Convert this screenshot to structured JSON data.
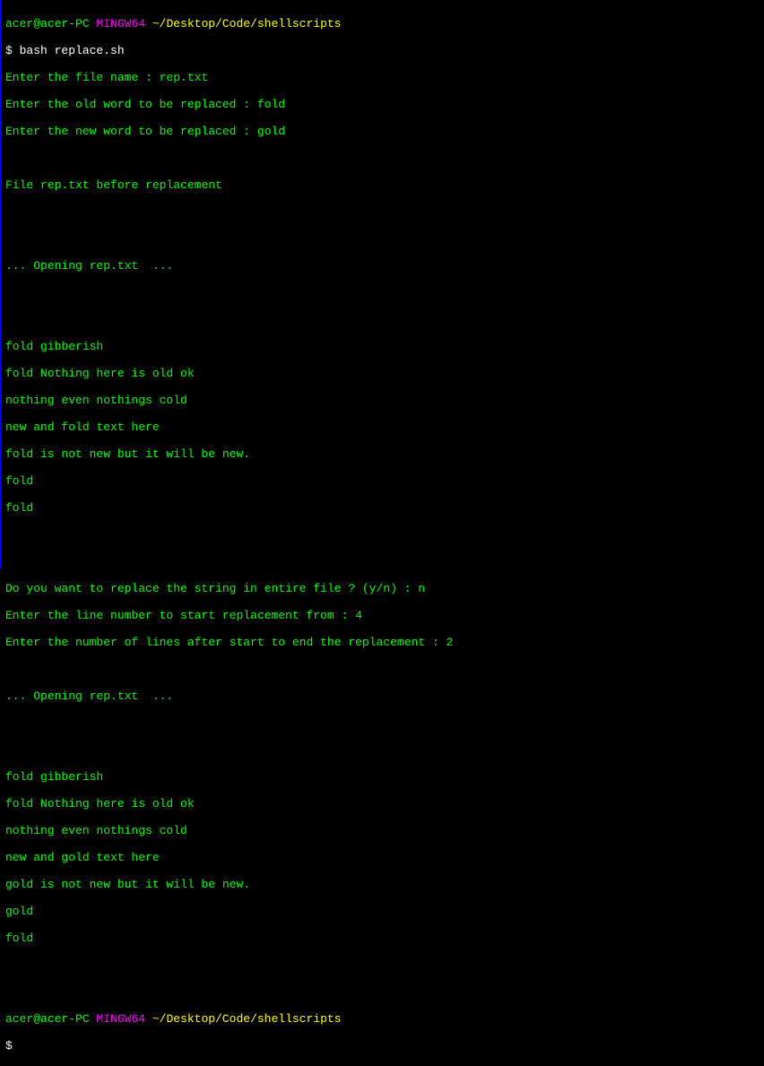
{
  "prompt1": {
    "user": "acer@acer-PC",
    "mingw": " MINGW64",
    "path": " ~/Desktop/Code/shellscripts"
  },
  "command1": {
    "dollar": "$ ",
    "cmd": "bash replace.sh"
  },
  "output": {
    "line1": "Enter the file name : rep.txt",
    "line2": "Enter the old word to be replaced : fold",
    "line3": "Enter the new word to be replaced : gold",
    "blank1": "",
    "line4": "File rep.txt before replacement",
    "blank2": "",
    "blank3": "",
    "line5": "... Opening rep.txt  ...",
    "blank4": "",
    "blank5": "",
    "line6": "fold gibberish",
    "line7": "fold Nothing here is old ok",
    "line8": "nothing even nothings cold",
    "line9": "new and fold text here",
    "line10": "fold is not new but it will be new.",
    "line11": "fold",
    "line12": "fold",
    "blank6": "",
    "blank7": "",
    "line13": "Do you want to replace the string in entire file ? (y/n) : n",
    "line14": "Enter the line number to start replacement from : 4",
    "line15": "Enter the number of lines after start to end the replacement : 2",
    "blank8": "",
    "line16": "... Opening rep.txt  ...",
    "blank9": "",
    "blank10": "",
    "line17": "fold gibberish",
    "line18": "fold Nothing here is old ok",
    "line19": "nothing even nothings cold",
    "line20": "new and gold text here",
    "line21": "gold is not new but it will be new.",
    "line22": "gold",
    "line23": "fold",
    "blank11": "",
    "blank12": ""
  },
  "prompt2": {
    "user": "acer@acer-PC",
    "mingw": " MINGW64",
    "path": " ~/Desktop/Code/shellscripts"
  },
  "command2": {
    "dollar": "$"
  }
}
